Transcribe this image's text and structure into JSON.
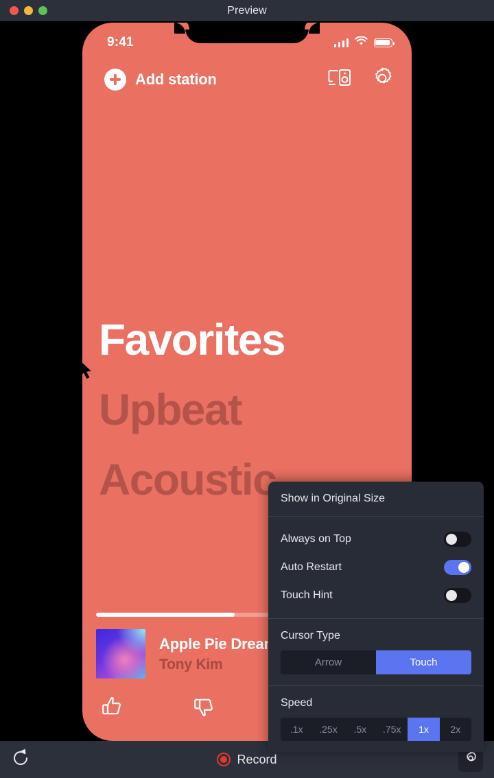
{
  "window": {
    "title": "Preview",
    "traffic_lights": [
      "close",
      "minimize",
      "maximize"
    ]
  },
  "phone": {
    "status_bar": {
      "time": "9:41",
      "signal_icon": "cellular-signal-icon",
      "wifi_icon": "wifi-icon",
      "battery_icon": "battery-icon"
    },
    "nav_bar": {
      "add_station_label": "Add station",
      "plus_icon": "plus-circle-icon",
      "cast_icon": "cast-speaker-icon",
      "settings_icon": "gear-icon"
    },
    "stations": [
      {
        "label": "Favorites",
        "state": "active"
      },
      {
        "label": "Upbeat",
        "state": "dim"
      },
      {
        "label": "Acoustic",
        "state": "dim"
      }
    ],
    "now_playing": {
      "progress_percent": 46,
      "album_art": "album-art-gradient",
      "title": "Apple Pie Dream",
      "artist": "Tony Kim",
      "thumbs_up_icon": "thumbs-up-icon",
      "thumbs_down_icon": "thumbs-down-icon"
    },
    "cursor": "arrow-cursor"
  },
  "settings_panel": {
    "original_size_label": "Show in Original Size",
    "toggles": [
      {
        "label": "Always on Top",
        "on": false
      },
      {
        "label": "Auto Restart",
        "on": true
      },
      {
        "label": "Touch Hint",
        "on": false
      }
    ],
    "cursor_type": {
      "label": "Cursor Type",
      "options": [
        "Arrow",
        "Touch"
      ],
      "selected": "Touch"
    },
    "speed": {
      "label": "Speed",
      "options": [
        ".1x",
        ".25x",
        ".5x",
        ".75x",
        "1x",
        "2x"
      ],
      "selected": "1x"
    }
  },
  "toolbar": {
    "restart_icon": "restart-icon",
    "record_label": "Record",
    "record_icon": "record-dot-icon",
    "settings_icon": "gear-icon"
  },
  "colors": {
    "accent_blue": "#5b74f0",
    "app_background": "#ea7062",
    "panel_background": "#282c36",
    "chrome_background": "#2c303a",
    "record_red": "#e03a30",
    "station_dim": "#b4534a"
  }
}
